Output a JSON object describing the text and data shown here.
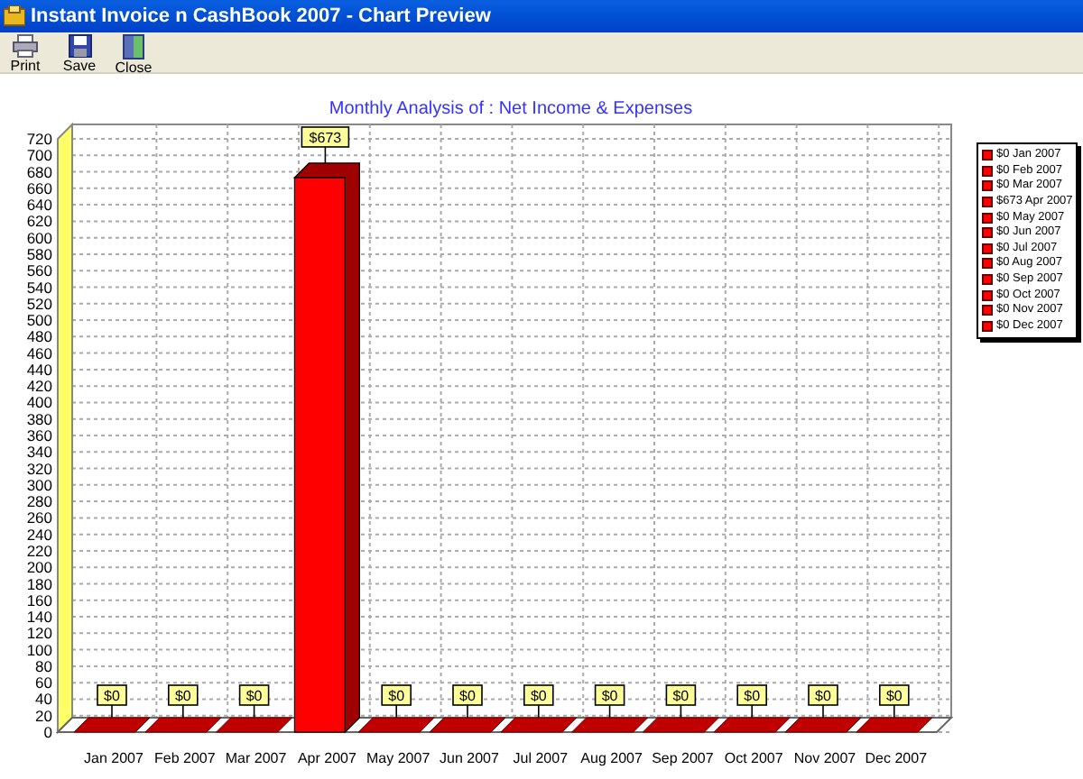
{
  "window": {
    "title": "Instant Invoice n CashBook 2007 - Chart Preview"
  },
  "toolbar": [
    {
      "label": "Print",
      "kind": "print"
    },
    {
      "label": "Save",
      "kind": "save"
    },
    {
      "label": "Close",
      "kind": "close"
    }
  ],
  "chart": {
    "chart_data": {
      "type": "bar",
      "title": "Monthly Analysis of : Net Income & Expenses",
      "categories": [
        "Jan 2007",
        "Feb 2007",
        "Mar 2007",
        "Apr 2007",
        "May 2007",
        "Jun 2007",
        "Jul 2007",
        "Aug 2007",
        "Sep 2007",
        "Oct 2007",
        "Nov 2007",
        "Dec 2007"
      ],
      "series": [
        {
          "color": "#ff0000",
          "values": [
            0,
            0,
            0,
            673,
            0,
            0,
            0,
            0,
            0,
            0,
            0,
            0
          ]
        }
      ],
      "grid": true,
      "value_labels": [
        "$0",
        "$0",
        "$0",
        "$673",
        "$0",
        "$0",
        "$0",
        "$0",
        "$0",
        "$0",
        "$0",
        "$0"
      ],
      "ylim": [
        0,
        720
      ],
      "yticks": [
        0,
        20,
        40,
        60,
        80,
        100,
        120,
        140,
        160,
        180,
        200,
        220,
        240,
        260,
        280,
        300,
        320,
        340,
        360,
        380,
        400,
        420,
        440,
        460,
        480,
        500,
        520,
        540,
        560,
        580,
        600,
        620,
        640,
        660,
        680,
        700,
        720
      ]
    },
    "legend": [
      {
        "label": "$0 Jan 2007"
      },
      {
        "label": "$0 Feb 2007"
      },
      {
        "label": "$0 Mar 2007"
      },
      {
        "label": "$673 Apr 2007"
      },
      {
        "label": "$0 May 2007"
      },
      {
        "label": "$0 Jun 2007"
      },
      {
        "label": "$0 Jul 2007"
      },
      {
        "label": "$0 Aug 2007"
      },
      {
        "label": "$0 Sep 2007"
      },
      {
        "label": "$0 Oct 2007"
      },
      {
        "label": "$0 Nov 2007"
      },
      {
        "label": "$0 Dec 2007"
      }
    ]
  }
}
